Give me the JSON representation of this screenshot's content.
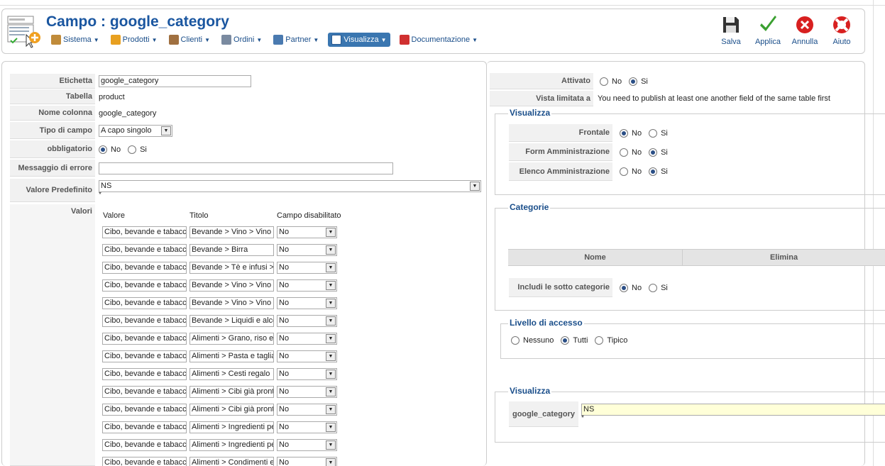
{
  "header": {
    "title": "Campo : google_category",
    "menu": [
      {
        "label": "Sistema",
        "icon": "tools-icon",
        "color": "#c08b3a"
      },
      {
        "label": "Prodotti",
        "icon": "box-icon",
        "color": "#e8a020"
      },
      {
        "label": "Clienti",
        "icon": "users-icon",
        "color": "#a07040"
      },
      {
        "label": "Ordini",
        "icon": "orders-icon",
        "color": "#7a8aa0"
      },
      {
        "label": "Partner",
        "icon": "partner-icon",
        "color": "#4a7ab0"
      },
      {
        "label": "Visualizza",
        "icon": "display-icon",
        "color": "#ffffff",
        "active": true
      },
      {
        "label": "Documentazione",
        "icon": "lifebuoy-icon",
        "color": "#d03030"
      }
    ],
    "toolbar": {
      "save": "Salva",
      "apply": "Applica",
      "cancel": "Annulla",
      "help": "Aiuto"
    }
  },
  "form": {
    "etichetta": {
      "label": "Etichetta",
      "value": "google_category"
    },
    "tabella": {
      "label": "Tabella",
      "value": "product"
    },
    "nome_colonna": {
      "label": "Nome colonna",
      "value": "google_category"
    },
    "tipo_campo": {
      "label": "Tipo di campo",
      "value": "A capo singolo"
    },
    "obbligatorio": {
      "label": "obbligatorio",
      "no": "No",
      "si": "Si"
    },
    "messaggio_errore": {
      "label": "Messaggio di errore",
      "value": ""
    },
    "valore_predefinito": {
      "label": "Valore Predefinito",
      "value": "NS",
      "star": "*"
    },
    "valori": {
      "label": "Valori",
      "col_valore": "Valore",
      "col_titolo": "Titolo",
      "col_disabilitato": "Campo disabilitato",
      "rows": [
        {
          "valore": "Cibo, bevande e tabacco",
          "titolo": "Bevande > Vino > Vino di",
          "disab": "No"
        },
        {
          "valore": "Cibo, bevande e tabacco",
          "titolo": "Bevande > Birra",
          "disab": "No"
        },
        {
          "valore": "Cibo, bevande e tabacco",
          "titolo": "Bevande > Tè e infusi >",
          "disab": "No"
        },
        {
          "valore": "Cibo, bevande e tabacco",
          "titolo": "Bevande > Vino > Vino b",
          "disab": "No"
        },
        {
          "valore": "Cibo, bevande e tabacco",
          "titolo": "Bevande > Vino > Vino d",
          "disab": "No"
        },
        {
          "valore": "Cibo, bevande e tabacco",
          "titolo": "Bevande > Liquidi e alco",
          "disab": "No"
        },
        {
          "valore": "Cibo, bevande e tabacco",
          "titolo": "Alimenti > Grano, riso e c",
          "disab": "No"
        },
        {
          "valore": "Cibo, bevande e tabacco",
          "titolo": "Alimenti > Pasta e tagliat",
          "disab": "No"
        },
        {
          "valore": "Cibo, bevande e tabacco",
          "titolo": "Alimenti > Cesti regalo",
          "disab": "No"
        },
        {
          "valore": "Cibo, bevande e tabacco",
          "titolo": "Alimenti > Cibi già pronti",
          "disab": "No"
        },
        {
          "valore": "Cibo, bevande e tabacco",
          "titolo": "Alimenti > Cibi già pronti :",
          "disab": "No"
        },
        {
          "valore": "Cibo, bevande e tabacco",
          "titolo": "Alimenti > Ingredienti per",
          "disab": "No"
        },
        {
          "valore": "Cibo, bevande e tabacco",
          "titolo": "Alimenti > Ingredienti per",
          "disab": "No"
        },
        {
          "valore": "Cibo, bevande e tabacco",
          "titolo": "Alimenti > Condimenti e s",
          "disab": "No"
        }
      ]
    }
  },
  "right": {
    "attivato": {
      "label": "Attivato",
      "no": "No",
      "si": "Si"
    },
    "vista_limitata": {
      "label": "Vista limitata a",
      "value": "You need to publish at least one another field of the same table first"
    },
    "visualizza": {
      "legend": "Visualizza",
      "frontale": "Frontale",
      "form_admin": "Form Amministrazione",
      "elenco_admin": "Elenco Amministrazione",
      "no": "No",
      "si": "Si"
    },
    "categorie": {
      "legend": "Categorie",
      "col_nome": "Nome",
      "col_elimina": "Elimina",
      "includi": "Includi le sotto categorie",
      "no": "No",
      "si": "Si"
    },
    "accesso": {
      "legend": "Livello di accesso",
      "nessuno": "Nessuno",
      "tutti": "Tutti",
      "tipico": "Tipico"
    },
    "visualizza2": {
      "legend": "Visualizza",
      "field_label": "google_category",
      "value": "NS",
      "star": "*"
    }
  }
}
